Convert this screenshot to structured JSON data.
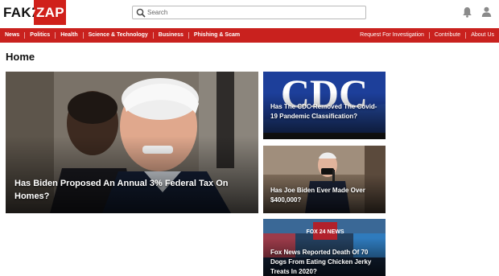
{
  "header": {
    "logo": {
      "word1": "FAKE",
      "word2": "ZAP"
    },
    "search": {
      "placeholder": "Search"
    },
    "icons": [
      "search-icon",
      "bell-icon",
      "user-icon"
    ]
  },
  "nav": {
    "left": [
      "News",
      "Politics",
      "Health",
      "Science & Technology",
      "Business",
      "Phishing & Scam"
    ],
    "right": [
      "Request For Investigation",
      "Contribute",
      "About Us"
    ]
  },
  "page": {
    "title": "Home"
  },
  "cards": {
    "main": {
      "headline": "Has Biden Proposed An Annual 3% Federal Tax On Homes?"
    },
    "side": [
      {
        "headline": "Has The CDC Removed The Covid-19 Pandemic Classification?",
        "image_text": "CDC"
      },
      {
        "headline": "Has Joe Biden Ever Made Over $400,000?"
      },
      {
        "headline": "Fox News Reported Death Of 70 Dogs From Eating Chicken Jerky Treats In 2020?",
        "image_text": "FOX 24 NEWS"
      }
    ]
  },
  "colors": {
    "brand_red": "#c9211e",
    "logo_red": "#d0201a",
    "cdc_blue": "#1d3f9a"
  }
}
